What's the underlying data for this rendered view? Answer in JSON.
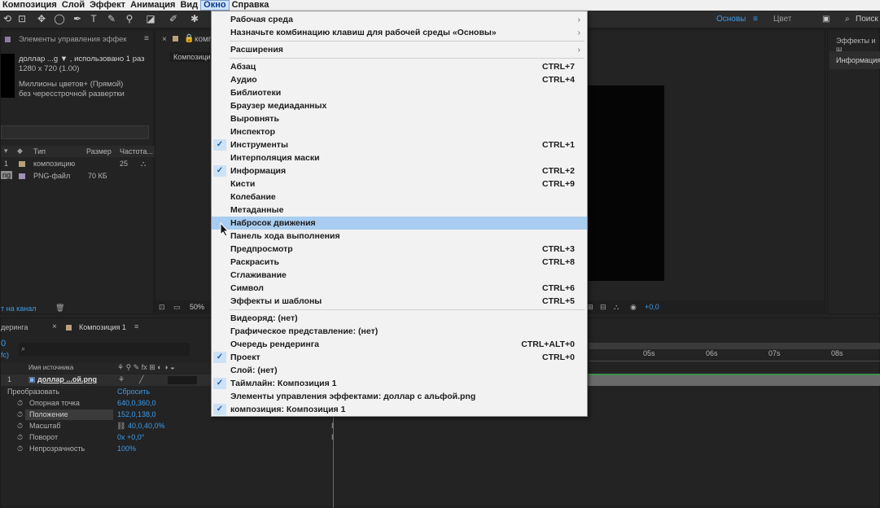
{
  "menubar": {
    "items": [
      "Композиция",
      "Слой",
      "Эффект",
      "Анимация",
      "Вид",
      "Окно",
      "Справка"
    ],
    "active": "Окно"
  },
  "toolbar": {
    "workspace_basic": "Основы",
    "workspace_color": "Цвет",
    "search_placeholder": "Поиск"
  },
  "project_panel": {
    "tab_label": "Элементы управления эффек",
    "file_name": "доллар ...g ▼ , использовано 1 раз",
    "dimensions": "1280 x 720 (1.00)",
    "color_info": "Миллионы цветов+ (Прямой)",
    "scan_info": "без чересстрочной развертки",
    "columns": [
      "Тип",
      "Размер",
      "Частота..."
    ],
    "rows": [
      {
        "index": "1",
        "type": "композицию",
        "size": "",
        "rate": "25"
      },
      {
        "index": "ng",
        "type": "PNG-файл",
        "size": "70 КБ",
        "rate": ""
      }
    ],
    "footer_link": "т на канал"
  },
  "composition_panel": {
    "tab_label": "композиция",
    "subtab": "Композици",
    "zoom": "50%",
    "exposure": "+0,0"
  },
  "right_panel": {
    "tab_effects": "Эффекты и ш",
    "tab_info": "Информация"
  },
  "timeline": {
    "tab_render": "деринга",
    "tab_comp": "Композиция 1",
    "timecode_fps": "fc)",
    "column_source": "Имя источника",
    "layer_index": "1",
    "layer_name": "доллар ...ой.png",
    "transform_label": "Преобразовать",
    "reset_label": "Сбросить",
    "properties": [
      {
        "name": "Опорная точка",
        "value": "640,0,360,0"
      },
      {
        "name": "Положение",
        "value": "152,0,138,0"
      },
      {
        "name": "Масштаб",
        "value": "40,0,40,0%"
      },
      {
        "name": "Поворот",
        "value": "0x +0,0°"
      },
      {
        "name": "Непрозрачность",
        "value": "100%"
      }
    ],
    "ruler": [
      "05s",
      "06s",
      "07s",
      "08s"
    ]
  },
  "window_menu": {
    "items": [
      {
        "label": "Рабочая среда",
        "shortcut": "",
        "checked": false,
        "submenu": true
      },
      {
        "label": "Назначьте комбинацию клавиш для рабочей среды «Основы»",
        "shortcut": "",
        "checked": false,
        "submenu": true
      },
      {
        "label": "Расширения",
        "shortcut": "",
        "checked": false,
        "submenu": true
      },
      {
        "label": "Абзац",
        "shortcut": "CTRL+7",
        "checked": false
      },
      {
        "label": "Аудио",
        "shortcut": "CTRL+4",
        "checked": false
      },
      {
        "label": "Библиотеки",
        "shortcut": "",
        "checked": false
      },
      {
        "label": "Браузер медиаданных",
        "shortcut": "",
        "checked": false
      },
      {
        "label": "Выровнять",
        "shortcut": "",
        "checked": false
      },
      {
        "label": "Инспектор",
        "shortcut": "",
        "checked": false
      },
      {
        "label": "Инструменты",
        "shortcut": "CTRL+1",
        "checked": true
      },
      {
        "label": "Интерполяция маски",
        "shortcut": "",
        "checked": false
      },
      {
        "label": "Информация",
        "shortcut": "CTRL+2",
        "checked": true
      },
      {
        "label": "Кисти",
        "shortcut": "CTRL+9",
        "checked": false
      },
      {
        "label": "Колебание",
        "shortcut": "",
        "checked": false
      },
      {
        "label": "Метаданные",
        "shortcut": "",
        "checked": false
      },
      {
        "label": "Набросок движения",
        "shortcut": "",
        "checked": false,
        "highlighted": true
      },
      {
        "label": "Панель хода выполнения",
        "shortcut": "",
        "checked": false
      },
      {
        "label": "Предпросмотр",
        "shortcut": "CTRL+3",
        "checked": false
      },
      {
        "label": "Раскрасить",
        "shortcut": "CTRL+8",
        "checked": false
      },
      {
        "label": "Сглаживание",
        "shortcut": "",
        "checked": false
      },
      {
        "label": "Символ",
        "shortcut": "CTRL+6",
        "checked": false
      },
      {
        "label": "Эффекты и шаблоны",
        "shortcut": "CTRL+5",
        "checked": false
      },
      {
        "label": "Видеоряд: (нет)",
        "shortcut": "",
        "checked": false
      },
      {
        "label": "Графическое представление: (нет)",
        "shortcut": "",
        "checked": false
      },
      {
        "label": "Очередь рендеринга",
        "shortcut": "CTRL+ALT+0",
        "checked": false
      },
      {
        "label": "Проект",
        "shortcut": "CTRL+0",
        "checked": true
      },
      {
        "label": "Слой: (нет)",
        "shortcut": "",
        "checked": false
      },
      {
        "label": "Таймлайн: Композиция 1",
        "shortcut": "",
        "checked": true
      },
      {
        "label": "Элементы управления эффектами: доллар с альфой.png",
        "shortcut": "",
        "checked": false
      },
      {
        "label": "композиция: Композиция 1",
        "shortcut": "",
        "checked": true
      }
    ]
  },
  "colors": {
    "accent_blue": "#3d9be9",
    "menu_highlight": "#a9cdf0",
    "panel_bg": "#232323"
  }
}
